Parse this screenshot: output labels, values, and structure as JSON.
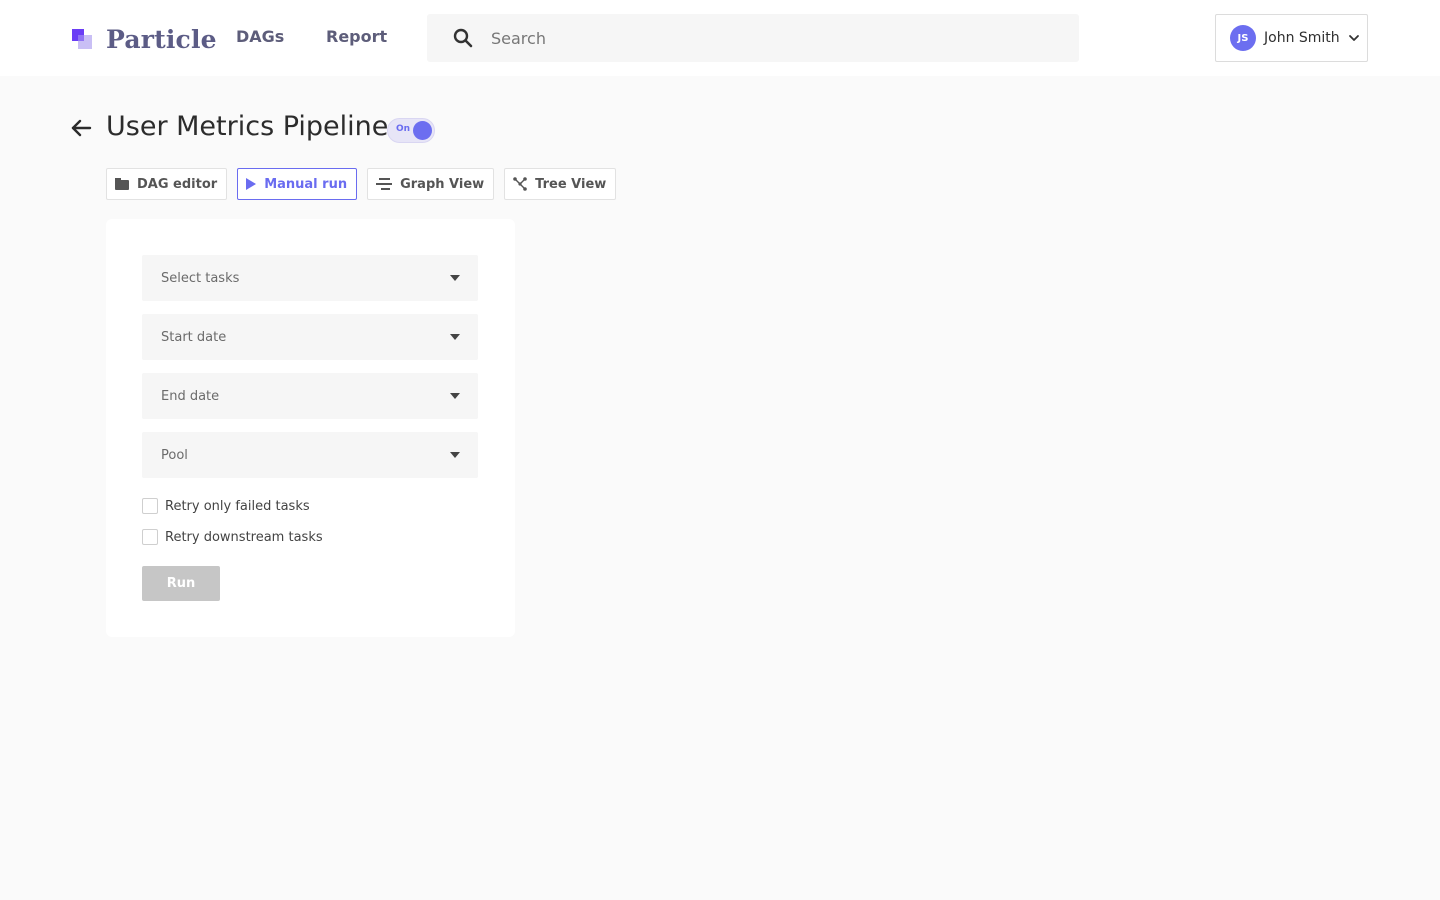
{
  "app": {
    "name": "Particle"
  },
  "nav": {
    "dags": "DAGs",
    "report": "Report"
  },
  "search": {
    "placeholder": "Search",
    "icon": "search-icon"
  },
  "user": {
    "initials": "JS",
    "name": "John Smith"
  },
  "page": {
    "title": "User Metrics Pipeline",
    "toggle_label": "On",
    "toggle_on": true
  },
  "tabs": [
    {
      "label": "DAG editor",
      "icon": "folder-icon",
      "active": false
    },
    {
      "label": "Manual run",
      "icon": "play-icon",
      "active": true
    },
    {
      "label": "Graph View",
      "icon": "graph-icon",
      "active": false
    },
    {
      "label": "Tree View",
      "icon": "tree-icon",
      "active": false
    }
  ],
  "form": {
    "selects": [
      {
        "placeholder": "Select tasks"
      },
      {
        "placeholder": "Start date"
      },
      {
        "placeholder": "End date"
      },
      {
        "placeholder": "Pool"
      }
    ],
    "checkboxes": [
      {
        "label": "Retry only failed tasks",
        "checked": false
      },
      {
        "label": "Retry downstream tasks",
        "checked": false
      }
    ],
    "run_label": "Run"
  },
  "colors": {
    "accent": "#6a6cf0",
    "logo_primary": "#6a3df5",
    "disabled_button": "#c6c6c6"
  }
}
